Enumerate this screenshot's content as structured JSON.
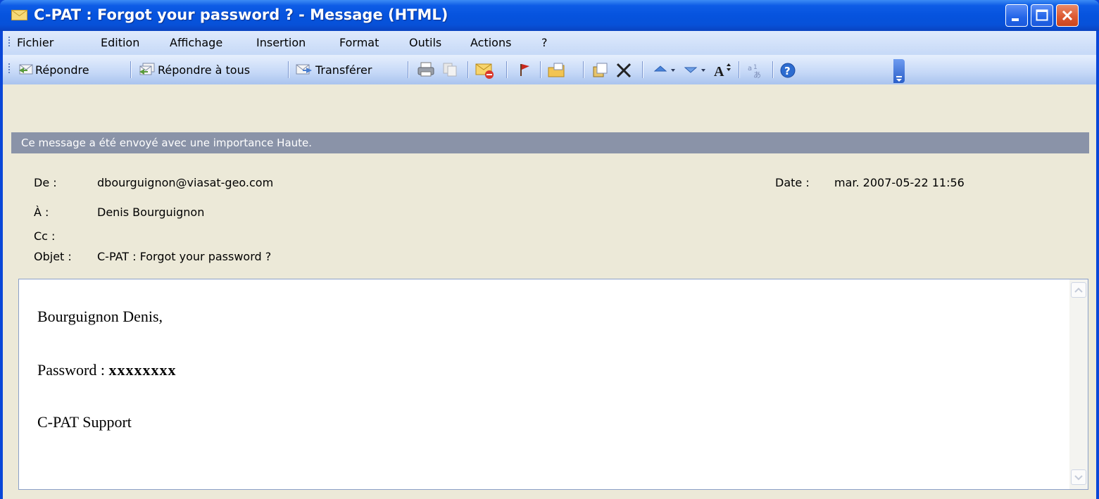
{
  "window": {
    "title": "C-PAT : Forgot your password ?  - Message (HTML)",
    "controls": [
      "minimize",
      "maximize",
      "close"
    ]
  },
  "menubar": {
    "items": [
      "Fichier",
      "Edition",
      "Affichage",
      "Insertion",
      "Format",
      "Outils",
      "Actions",
      "?"
    ]
  },
  "toolbar": {
    "reply_label": "Répondre",
    "reply_all_label": "Répondre à tous",
    "forward_label": "Transférer",
    "icons": [
      "reply-icon",
      "reply-all-icon",
      "forward-icon",
      "print-icon",
      "copy-icon",
      "mark-unread-icon",
      "flag-icon",
      "move-to-folder-icon",
      "move-icon",
      "delete-icon",
      "previous-item-icon",
      "next-item-icon",
      "font-size-icon",
      "encoding-icon",
      "help-icon"
    ]
  },
  "banner": {
    "text": "Ce message a été envoyé avec une importance Haute."
  },
  "header": {
    "from_label": "De :",
    "from_value": "dbourguignon@viasat-geo.com",
    "date_label": "Date :",
    "date_value": "mar. 2007-05-22 11:56",
    "to_label": "À :",
    "to_value": "Denis Bourguignon",
    "cc_label": "Cc :",
    "cc_value": "",
    "subject_label": "Objet :",
    "subject_value": "C-PAT : Forgot your password ?"
  },
  "body": {
    "greeting": "Bourguignon Denis,",
    "password_label": "Password : ",
    "password_value": "xxxxxxxx",
    "signature": "C-PAT Support"
  },
  "colors": {
    "titlebar": "#0653de",
    "window_border": "#0a47d8",
    "chrome_background": "#ece9d8",
    "banner": "#8a93a8",
    "toolbar": "#c5d8f7"
  }
}
